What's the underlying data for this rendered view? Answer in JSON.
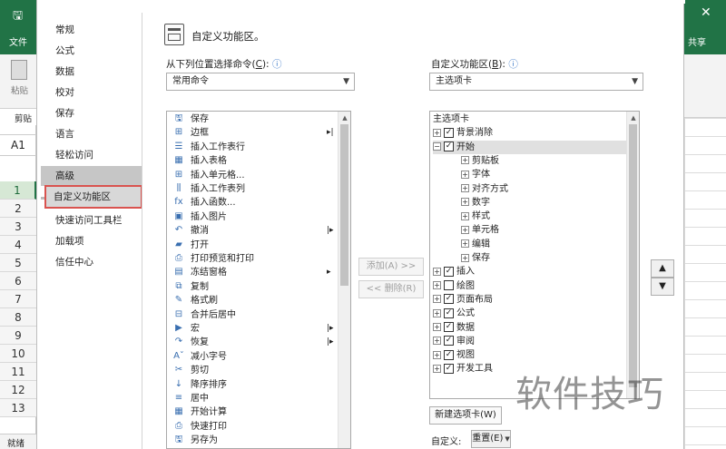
{
  "excel": {
    "file_tab": "文件",
    "share": "共享",
    "paste": "粘贴",
    "clipboard": "剪贴",
    "cell_ref": "A1",
    "rows": [
      "1",
      "2",
      "3",
      "4",
      "5",
      "6",
      "7",
      "8",
      "9",
      "10",
      "11",
      "12",
      "13"
    ],
    "ready": "就绪",
    "accent": "#217346"
  },
  "nav": {
    "items": [
      "常规",
      "公式",
      "数据",
      "校对",
      "保存",
      "语言",
      "轻松访问",
      "高级",
      "自定义功能区",
      "快速访问工具栏",
      "加载项",
      "信任中心"
    ],
    "selected": "自定义功能区"
  },
  "header": {
    "title": "自定义功能区。"
  },
  "left_panel": {
    "label_text": "从下列位置选择命令(",
    "label_key": "C",
    "label_end": "):",
    "info": "ⓘ",
    "dropdown_value": "常用命令",
    "commands": [
      {
        "icon": "save-icon",
        "glyph": "🖫",
        "label": "保存"
      },
      {
        "icon": "border-icon",
        "glyph": "⊞",
        "label": "边框",
        "arrow": "▸|"
      },
      {
        "icon": "insert-row-icon",
        "glyph": "☰",
        "label": "插入工作表行"
      },
      {
        "icon": "insert-table-icon",
        "glyph": "▦",
        "label": "插入表格"
      },
      {
        "icon": "insert-cell-icon",
        "glyph": "⊞",
        "label": "插入单元格..."
      },
      {
        "icon": "insert-column-icon",
        "glyph": "⫼",
        "label": "插入工作表列"
      },
      {
        "icon": "function-icon",
        "glyph": "fx",
        "label": "插入函数..."
      },
      {
        "icon": "picture-icon",
        "glyph": "▣",
        "label": "插入图片"
      },
      {
        "icon": "undo-icon",
        "glyph": "↶",
        "label": "撤消",
        "arrow": "|▸"
      },
      {
        "icon": "open-icon",
        "glyph": "▰",
        "label": "打开"
      },
      {
        "icon": "print-preview-icon",
        "glyph": "⎙",
        "label": "打印预览和打印"
      },
      {
        "icon": "freeze-panes-icon",
        "glyph": "▤",
        "label": "冻结窗格",
        "arrow": "▸"
      },
      {
        "icon": "copy-icon",
        "glyph": "⧉",
        "label": "复制"
      },
      {
        "icon": "format-painter-icon",
        "glyph": "✎",
        "label": "格式刷"
      },
      {
        "icon": "merge-center-icon",
        "glyph": "⊟",
        "label": "合并后居中"
      },
      {
        "icon": "macro-icon",
        "glyph": "▶",
        "label": "宏",
        "arrow": "|▸"
      },
      {
        "icon": "redo-icon",
        "glyph": "↷",
        "label": "恢复",
        "arrow": "|▸"
      },
      {
        "icon": "decrease-font-icon",
        "glyph": "Aˇ",
        "label": "减小字号"
      },
      {
        "icon": "cut-icon",
        "glyph": "✂",
        "label": "剪切"
      },
      {
        "icon": "sort-desc-icon",
        "glyph": "↓",
        "label": "降序排序"
      },
      {
        "icon": "center-icon",
        "glyph": "≡",
        "label": "居中"
      },
      {
        "icon": "calculate-icon",
        "glyph": "▦",
        "label": "开始计算"
      },
      {
        "icon": "quick-print-icon",
        "glyph": "⎙",
        "label": "快速打印"
      },
      {
        "icon": "save-as-icon",
        "glyph": "🖫",
        "label": "另存为"
      }
    ]
  },
  "middle": {
    "add_button": "添加(A) >>",
    "remove_button": "<< 删除(R)"
  },
  "right_panel": {
    "label_text": "自定义功能区(",
    "label_key": "B",
    "label_end": "):",
    "info": "ⓘ",
    "dropdown_value": "主选项卡",
    "tree": [
      {
        "level": 0,
        "label": "主选项卡",
        "pm": "",
        "cb": ""
      },
      {
        "level": 1,
        "label": "背景消除",
        "pm": "+",
        "cb": "✓"
      },
      {
        "level": 1,
        "label": "开始",
        "pm": "−",
        "cb": "✓",
        "selected": true
      },
      {
        "level": 2,
        "label": "剪贴板",
        "pm": "+",
        "cb": ""
      },
      {
        "level": 2,
        "label": "字体",
        "pm": "+",
        "cb": ""
      },
      {
        "level": 2,
        "label": "对齐方式",
        "pm": "+",
        "cb": ""
      },
      {
        "level": 2,
        "label": "数字",
        "pm": "+",
        "cb": ""
      },
      {
        "level": 2,
        "label": "样式",
        "pm": "+",
        "cb": ""
      },
      {
        "level": 2,
        "label": "单元格",
        "pm": "+",
        "cb": ""
      },
      {
        "level": 2,
        "label": "编辑",
        "pm": "+",
        "cb": ""
      },
      {
        "level": 2,
        "label": "保存",
        "pm": "+",
        "cb": ""
      },
      {
        "level": 1,
        "label": "插入",
        "pm": "+",
        "cb": "✓"
      },
      {
        "level": 1,
        "label": "绘图",
        "pm": "+",
        "cb": " "
      },
      {
        "level": 1,
        "label": "页面布局",
        "pm": "+",
        "cb": "✓"
      },
      {
        "level": 1,
        "label": "公式",
        "pm": "+",
        "cb": "✓"
      },
      {
        "level": 1,
        "label": "数据",
        "pm": "+",
        "cb": "✓"
      },
      {
        "level": 1,
        "label": "审阅",
        "pm": "+",
        "cb": "✓"
      },
      {
        "level": 1,
        "label": "视图",
        "pm": "+",
        "cb": "✓"
      },
      {
        "level": 1,
        "label": "开发工具",
        "pm": "+",
        "cb": "✓"
      }
    ],
    "new_tab_button": "新建选项卡(W)",
    "customize_label": "自定义:",
    "reset_button": "重置(E)",
    "move_up": "▲",
    "move_down": "▼"
  },
  "watermark": "软件技巧"
}
